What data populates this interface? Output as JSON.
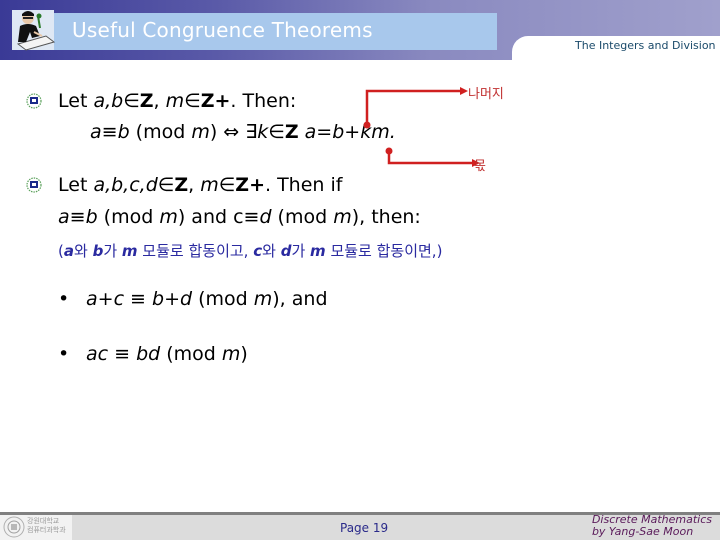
{
  "header": {
    "title": "Useful Congruence Theorems",
    "subtitle": "The Integers and Division",
    "logo_icon": "professor-at-desk-icon"
  },
  "theorem1": {
    "intro": {
      "let": "Let ",
      "vars": "a,b",
      "in1": "∈",
      "Z1": "Z",
      "comma": ", ",
      "m": "m",
      "in2": "∈",
      "Zplus": "Z+",
      "then": ".  Then:"
    },
    "statement": {
      "a": "a",
      "equiv": "≡",
      "b": "b",
      "mod_open": " (mod ",
      "m": "m",
      "mod_close": ") ",
      "iff": "⇔",
      "exists": " ∃",
      "k": "k",
      "in": "∈",
      "Z": "Z",
      "rhs": " a=b+km."
    },
    "annotations": {
      "remainder": "나머지",
      "quotient": "몫",
      "color": "#d02020"
    }
  },
  "theorem2": {
    "intro": {
      "let": "Let ",
      "vars": "a,b,c,d",
      "in1": "∈",
      "Z1": "Z",
      "comma": ", ",
      "m": "m",
      "in2": "∈",
      "Zplus": "Z+",
      "then": ".  Then if"
    },
    "condition": {
      "a": "a",
      "equiv1": "≡",
      "b": "b",
      "mod1_open": " (mod ",
      "m1": "m",
      "mod1_close": ") and c",
      "equiv2": "≡",
      "d": "d",
      "mod2_open": " (mod ",
      "m2": "m",
      "mod2_close": "), then:"
    },
    "korean_note": {
      "open": "(",
      "a": "a",
      "p1": "와 ",
      "b": "b",
      "p2": "가 ",
      "m1": "m",
      "p3": " 모듈로 합동이고, ",
      "c": "c",
      "p4": "와 ",
      "d": "d",
      "p5": "가 ",
      "m2": "m",
      "p6": " 모듈로 합동이면,)"
    },
    "results": [
      {
        "bullet": "•",
        "lhs": "a+c",
        "equiv": " ≡ ",
        "rhs": "b+d",
        "mod": " (mod ",
        "m": "m",
        "tail": "), and"
      },
      {
        "bullet": "•",
        "lhs": "ac",
        "equiv": " ≡ ",
        "rhs": "bd",
        "mod": " (mod ",
        "m": "m",
        "tail": ")"
      }
    ]
  },
  "bullet_icon": "university-seal-icon",
  "footer": {
    "school_line1": "강원대학교",
    "school_line2": "컴퓨터과학과",
    "page": "Page 19",
    "credit_line1": "Discrete Mathematics",
    "credit_line2": "by Yang-Sae Moon"
  }
}
